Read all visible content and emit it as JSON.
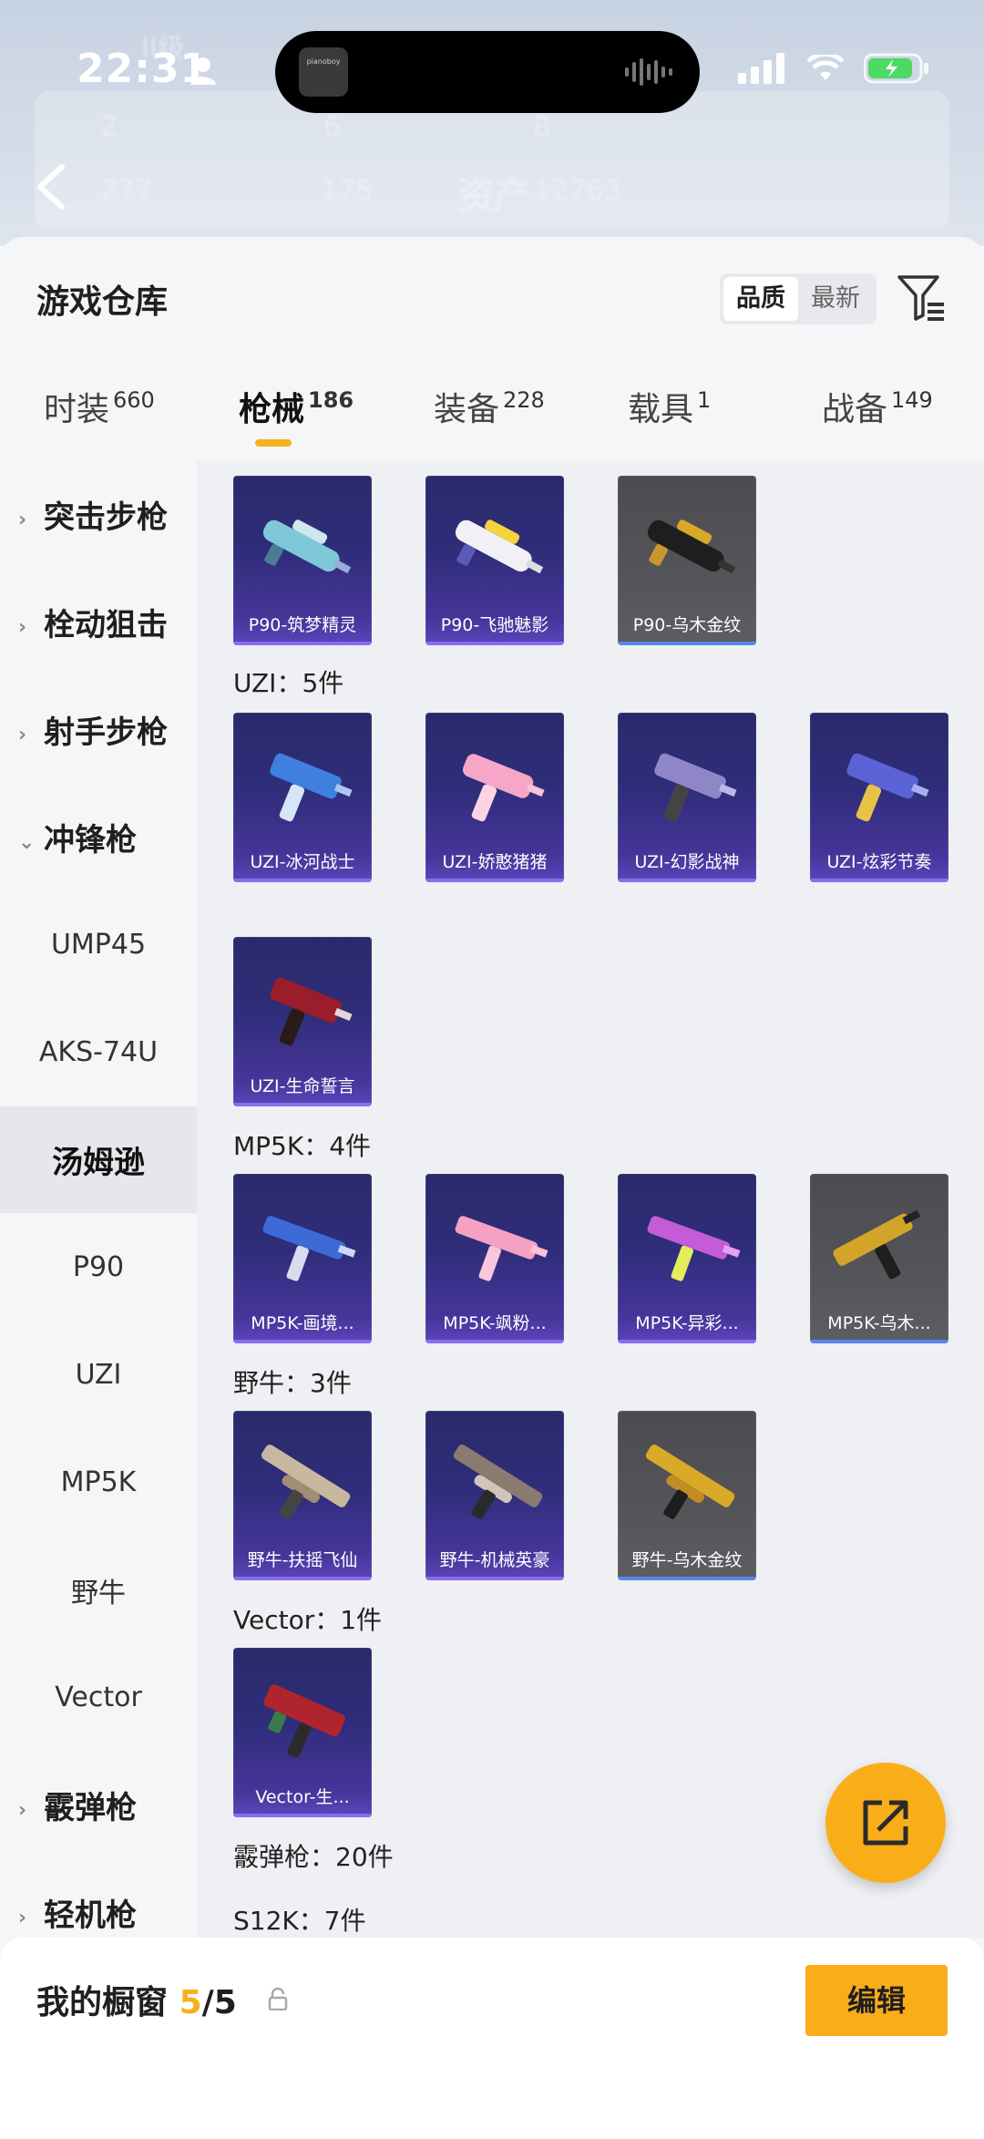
{
  "status_bar": {
    "time": "22:31",
    "island_thumb_text": "pianoboy"
  },
  "header_ghost": {
    "level": "II级",
    "assets_label": "资产",
    "assets_value": "12763",
    "values": [
      "2",
      "6",
      "8",
      "277",
      "175"
    ]
  },
  "sheet": {
    "title": "游戏仓库",
    "sort_quality": "品质",
    "sort_newest": "最新"
  },
  "tabs": [
    {
      "label": "时装",
      "count": "660"
    },
    {
      "label": "枪械",
      "count": "186"
    },
    {
      "label": "装备",
      "count": "228"
    },
    {
      "label": "载具",
      "count": "1"
    },
    {
      "label": "战备",
      "count": "149"
    }
  ],
  "sidebar": [
    {
      "label": "突击步枪"
    },
    {
      "label": "栓动狙击"
    },
    {
      "label": "射手步枪"
    },
    {
      "label": "冲锋枪"
    },
    {
      "label": "UMP45"
    },
    {
      "label": "AKS-74U"
    },
    {
      "label": "汤姆逊"
    },
    {
      "label": "P90"
    },
    {
      "label": "UZI"
    },
    {
      "label": "MP5K"
    },
    {
      "label": "野牛"
    },
    {
      "label": "Vector"
    },
    {
      "label": "霰弹枪"
    },
    {
      "label": "轻机枪"
    }
  ],
  "groups": {
    "uzi": "UZI：5件",
    "mp5k": "MP5K：4件",
    "bison": "野牛：3件",
    "vector": "Vector：1件",
    "shotgun": "霰弹枪：20件",
    "s12k": "S12K：7件"
  },
  "items": {
    "p90": [
      "P90-筑梦精灵",
      "P90-飞驰魅影",
      "P90-乌木金纹"
    ],
    "uzi": [
      "UZI-冰河战士",
      "UZI-娇憨猪猪",
      "UZI-幻影战神",
      "UZI-炫彩节奏",
      "UZI-生命誓言"
    ],
    "mp5k": [
      "MP5K-画境...",
      "MP5K-飒粉...",
      "MP5K-异彩...",
      "MP5K-乌木..."
    ],
    "bison": [
      "野牛-扶摇飞仙",
      "野牛-机械英豪",
      "野牛-乌木金纹"
    ],
    "vector": [
      "Vector-生..."
    ]
  },
  "footer": {
    "title": "我的橱窗",
    "count_current": "5",
    "count_total": "/5",
    "edit_label": "编辑"
  },
  "colors": {
    "accent": "#f9ae19",
    "card_purple": "#2f2d7a",
    "card_gold": "#555559"
  }
}
